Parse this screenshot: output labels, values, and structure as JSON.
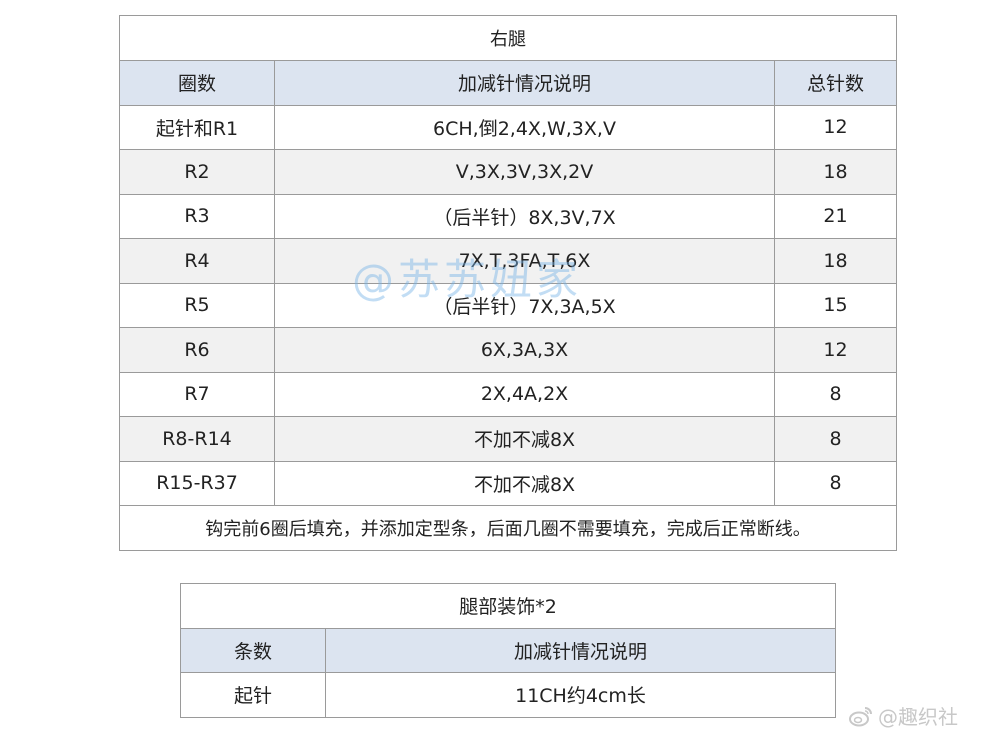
{
  "table1": {
    "title": "右腿",
    "headers": [
      "圈数",
      "加减针情况说明",
      "总针数"
    ],
    "rows": [
      [
        "起针和R1",
        "6CH,倒2,4X,W,3X,V",
        "12"
      ],
      [
        "R2",
        "V,3X,3V,3X,2V",
        "18"
      ],
      [
        "R3",
        "（后半针）8X,3V,7X",
        "21"
      ],
      [
        "R4",
        "7X,T,3FA,T,6X",
        "18"
      ],
      [
        "R5",
        "（后半针）7X,3A,5X",
        "15"
      ],
      [
        "R6",
        "6X,3A,3X",
        "12"
      ],
      [
        "R7",
        "2X,4A,2X",
        "8"
      ],
      [
        "R8-R14",
        "不加不减8X",
        "8"
      ],
      [
        "R15-R37",
        "不加不减8X",
        "8"
      ]
    ],
    "note": "钩完前6圈后填充，并添加定型条，后面几圈不需要填充，完成后正常断线。"
  },
  "table2": {
    "title": "腿部装饰*2",
    "headers": [
      "条数",
      "加减针情况说明"
    ],
    "rows": [
      [
        "起针",
        "11CH约4cm长"
      ]
    ]
  },
  "watermark": "@苏苏妞家",
  "weibo_credit": "@趣织社",
  "colors": {
    "header_bg": "#dce4f0",
    "alt_row_bg": "#f1f1f1",
    "border": "#9a9a9a"
  }
}
